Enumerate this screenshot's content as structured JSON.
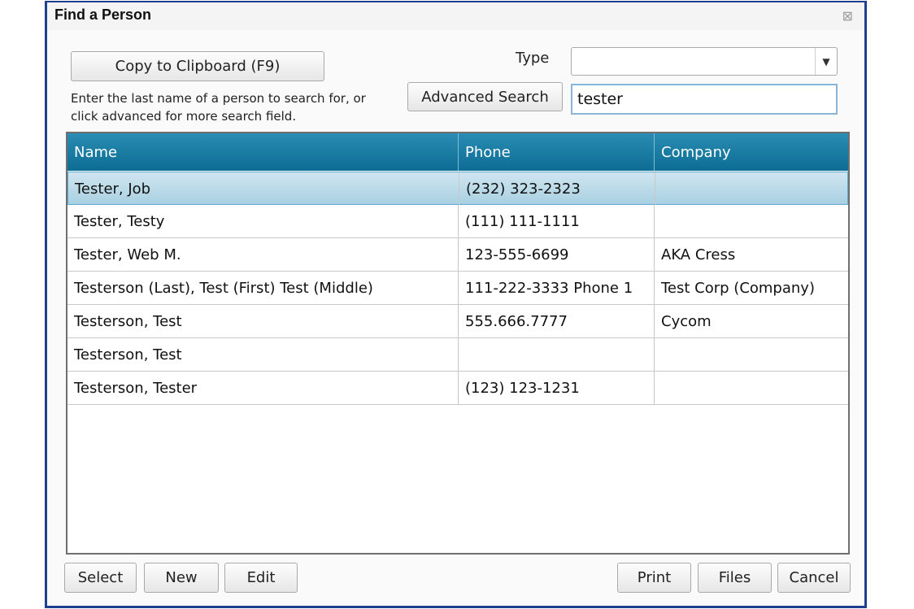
{
  "dialog": {
    "title": "Find a Person"
  },
  "toolbar": {
    "copy_label": "Copy to Clipboard (F9)",
    "hint": "Enter the last name of a person to search for, or click advanced for more search field.",
    "type_label": "Type",
    "type_value": "",
    "advanced_label": "Advanced Search",
    "search_value": "tester"
  },
  "grid": {
    "columns": [
      "Name",
      "Phone",
      "Company"
    ],
    "rows": [
      {
        "name": "Tester, Job",
        "phone": "(232) 323-2323",
        "company": "",
        "selected": true
      },
      {
        "name": "Tester, Testy",
        "phone": "(111) 111-1111",
        "company": ""
      },
      {
        "name": "Tester, Web M.",
        "phone": "123-555-6699",
        "company": "AKA Cress"
      },
      {
        "name": "Testerson (Last), Test (First) Test (Middle)",
        "phone": "111-222-3333 Phone 1",
        "company": "Test Corp (Company)"
      },
      {
        "name": "Testerson, Test",
        "phone": "555.666.7777",
        "company": "Cycom"
      },
      {
        "name": "Testerson, Test",
        "phone": "",
        "company": ""
      },
      {
        "name": "Testerson, Tester",
        "phone": "(123) 123-1231",
        "company": ""
      }
    ]
  },
  "footer": {
    "select_label": "Select",
    "new_label": "New",
    "edit_label": "Edit",
    "print_label": "Print",
    "files_label": "Files",
    "cancel_label": "Cancel"
  },
  "icons": {
    "close": "close-icon",
    "dropdown": "chevron-down-icon"
  },
  "colors": {
    "header": "#1a7ea6",
    "selected_row": "#b8dbe9",
    "border": "#1e3f8f"
  }
}
